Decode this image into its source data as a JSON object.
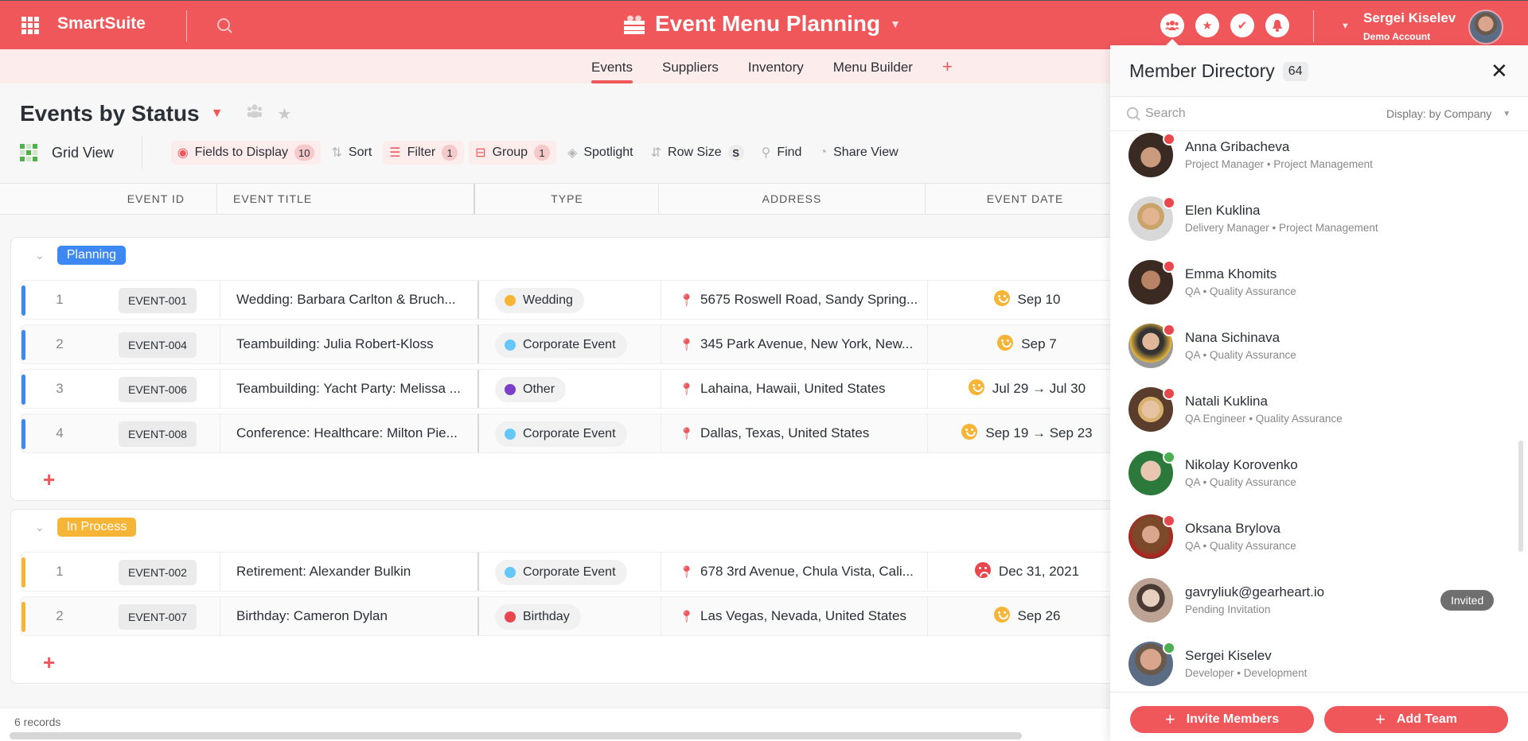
{
  "colors": {
    "brand": "#F0575B",
    "planning": "#3D88F2",
    "in_process": "#F7B538",
    "type_wedding": "#F7B538",
    "type_corporate": "#66C8FA",
    "type_other": "#7C3FCC",
    "type_birthday": "#E8484D"
  },
  "header": {
    "brand": "SmartSuite",
    "apps_icon": "grid-icon",
    "search_icon": "search-icon",
    "app_title": "Event Menu Planning",
    "app_icon": "food-crate-icon",
    "icons": [
      "members-icon",
      "star-icon",
      "check-icon",
      "bell-icon"
    ],
    "user_name": "Sergei Kiselev",
    "user_sub": "Demo Account"
  },
  "tabs": [
    {
      "label": "Events",
      "active": true
    },
    {
      "label": "Suppliers",
      "active": false
    },
    {
      "label": "Inventory",
      "active": false
    },
    {
      "label": "Menu Builder",
      "active": false
    }
  ],
  "view": {
    "title": "Events by Status",
    "view_type": "Grid View"
  },
  "toolbar": {
    "fields_label": "Fields to Display",
    "fields_count": "10",
    "sort_label": "Sort",
    "filter_label": "Filter",
    "filter_count": "1",
    "group_label": "Group",
    "group_count": "1",
    "spotlight_label": "Spotlight",
    "rowsize_label": "Row Size",
    "rowsize_value": "S",
    "find_label": "Find",
    "share_label": "Share View"
  },
  "columns": [
    "EVENT ID",
    "EVENT TITLE",
    "TYPE",
    "ADDRESS",
    "EVENT DATE"
  ],
  "groups": [
    {
      "status": "Planning",
      "rows": [
        {
          "num": "1",
          "id": "EVENT-001",
          "title": "Wedding: Barbara Carlton & Bruch...",
          "type": "Wedding",
          "address": "5675 Roswell Road, Sandy Spring...",
          "date": "Sep 10",
          "mood": "happy"
        },
        {
          "num": "2",
          "id": "EVENT-004",
          "title": "Teambuilding: Julia Robert-Kloss",
          "type": "Corporate Event",
          "address": "345 Park Avenue, New York, New...",
          "date": "Sep 7",
          "mood": "happy"
        },
        {
          "num": "3",
          "id": "EVENT-006",
          "title": "Teambuilding: Yacht Party: Melissa ...",
          "type": "Other",
          "address": "Lahaina, Hawaii, United States",
          "date": "Jul 29 → Jul 30",
          "mood": "happy"
        },
        {
          "num": "4",
          "id": "EVENT-008",
          "title": "Conference: Healthcare: Milton Pie...",
          "type": "Corporate Event",
          "address": "Dallas, Texas, United States",
          "date": "Sep 19 → Sep 23",
          "mood": "happy"
        }
      ]
    },
    {
      "status": "In Process",
      "rows": [
        {
          "num": "1",
          "id": "EVENT-002",
          "title": "Retirement: Alexander Bulkin",
          "type": "Corporate Event",
          "address": "678 3rd Avenue, Chula Vista, Cali...",
          "date": "Dec 31, 2021",
          "mood": "sad"
        },
        {
          "num": "2",
          "id": "EVENT-007",
          "title": "Birthday: Cameron Dylan",
          "type": "Birthday",
          "address": "Las Vegas, Nevada, United States",
          "date": "Sep 26",
          "mood": "happy"
        }
      ]
    }
  ],
  "footer": {
    "records": "6 records"
  },
  "panel": {
    "title": "Member Directory",
    "count": "64",
    "search_placeholder": "Search",
    "display_label": "Display: by Company",
    "members": [
      {
        "name": "Anna Gribacheva",
        "role": "Project Manager",
        "dept": "Project Management",
        "status": "offline"
      },
      {
        "name": "Elen Kuklina",
        "role": "Delivery Manager",
        "dept": "Project Management",
        "status": "offline"
      },
      {
        "name": "Emma Khomits",
        "role": "QA",
        "dept": "Quality Assurance",
        "status": "offline"
      },
      {
        "name": "Nana Sichinava",
        "role": "QA",
        "dept": "Quality Assurance",
        "status": "offline"
      },
      {
        "name": "Natali Kuklina",
        "role": "QA Engineer",
        "dept": "Quality Assurance",
        "status": "offline"
      },
      {
        "name": "Nikolay Korovenko",
        "role": "QA",
        "dept": "Quality Assurance",
        "status": "online"
      },
      {
        "name": "Oksana Brylova",
        "role": "QA",
        "dept": "Quality Assurance",
        "status": "offline"
      },
      {
        "name": "gavryliuk@gearheart.io",
        "role": "",
        "dept": "Pending Invitation",
        "status": "invited",
        "badge": "Invited"
      },
      {
        "name": "Sergei Kiselev",
        "role": "Developer",
        "dept": "Development",
        "status": "online"
      }
    ],
    "invite_label": "Invite Members",
    "add_team_label": "Add Team"
  }
}
